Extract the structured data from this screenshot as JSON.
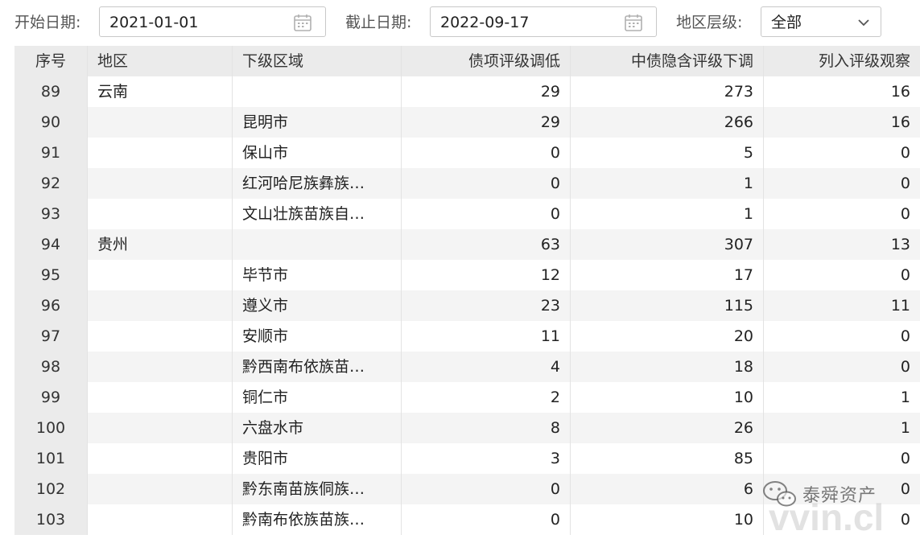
{
  "filters": {
    "start_label": "开始日期:",
    "start_value": "2021-01-01",
    "end_label": "截止日期:",
    "end_value": "2022-09-17",
    "level_label": "地区层级:",
    "level_value": "全部"
  },
  "table": {
    "headers": [
      "序号",
      "地区",
      "下级区域",
      "债项评级调低",
      "中债隐含评级下调",
      "列入评级观察"
    ],
    "rows": [
      {
        "no": "89",
        "region": "云南",
        "sub": "",
        "c1": "29",
        "c2": "273",
        "c3": "16"
      },
      {
        "no": "90",
        "region": "",
        "sub": "昆明市",
        "c1": "29",
        "c2": "266",
        "c3": "16"
      },
      {
        "no": "91",
        "region": "",
        "sub": "保山市",
        "c1": "0",
        "c2": "5",
        "c3": "0"
      },
      {
        "no": "92",
        "region": "",
        "sub": "红河哈尼族彝族…",
        "c1": "0",
        "c2": "1",
        "c3": "0"
      },
      {
        "no": "93",
        "region": "",
        "sub": "文山壮族苗族自…",
        "c1": "0",
        "c2": "1",
        "c3": "0"
      },
      {
        "no": "94",
        "region": "贵州",
        "sub": "",
        "c1": "63",
        "c2": "307",
        "c3": "13"
      },
      {
        "no": "95",
        "region": "",
        "sub": "毕节市",
        "c1": "12",
        "c2": "17",
        "c3": "0"
      },
      {
        "no": "96",
        "region": "",
        "sub": "遵义市",
        "c1": "23",
        "c2": "115",
        "c3": "11"
      },
      {
        "no": "97",
        "region": "",
        "sub": "安顺市",
        "c1": "11",
        "c2": "20",
        "c3": "0"
      },
      {
        "no": "98",
        "region": "",
        "sub": "黔西南布依族苗…",
        "c1": "4",
        "c2": "18",
        "c3": "0"
      },
      {
        "no": "99",
        "region": "",
        "sub": "铜仁市",
        "c1": "2",
        "c2": "10",
        "c3": "1"
      },
      {
        "no": "100",
        "region": "",
        "sub": "六盘水市",
        "c1": "8",
        "c2": "26",
        "c3": "1"
      },
      {
        "no": "101",
        "region": "",
        "sub": "贵阳市",
        "c1": "3",
        "c2": "85",
        "c3": "0"
      },
      {
        "no": "102",
        "region": "",
        "sub": "黔东南苗族侗族…",
        "c1": "0",
        "c2": "6",
        "c3": "0"
      },
      {
        "no": "103",
        "region": "",
        "sub": "黔南布依族苗族…",
        "c1": "0",
        "c2": "10",
        "c3": "0"
      }
    ]
  },
  "watermark": {
    "text": "泰舜资产",
    "big": "vvin.cl"
  },
  "icons": {
    "calendar": "calendar-icon",
    "dropdown": "chevron-down-icon",
    "wechat": "wechat-logo"
  }
}
